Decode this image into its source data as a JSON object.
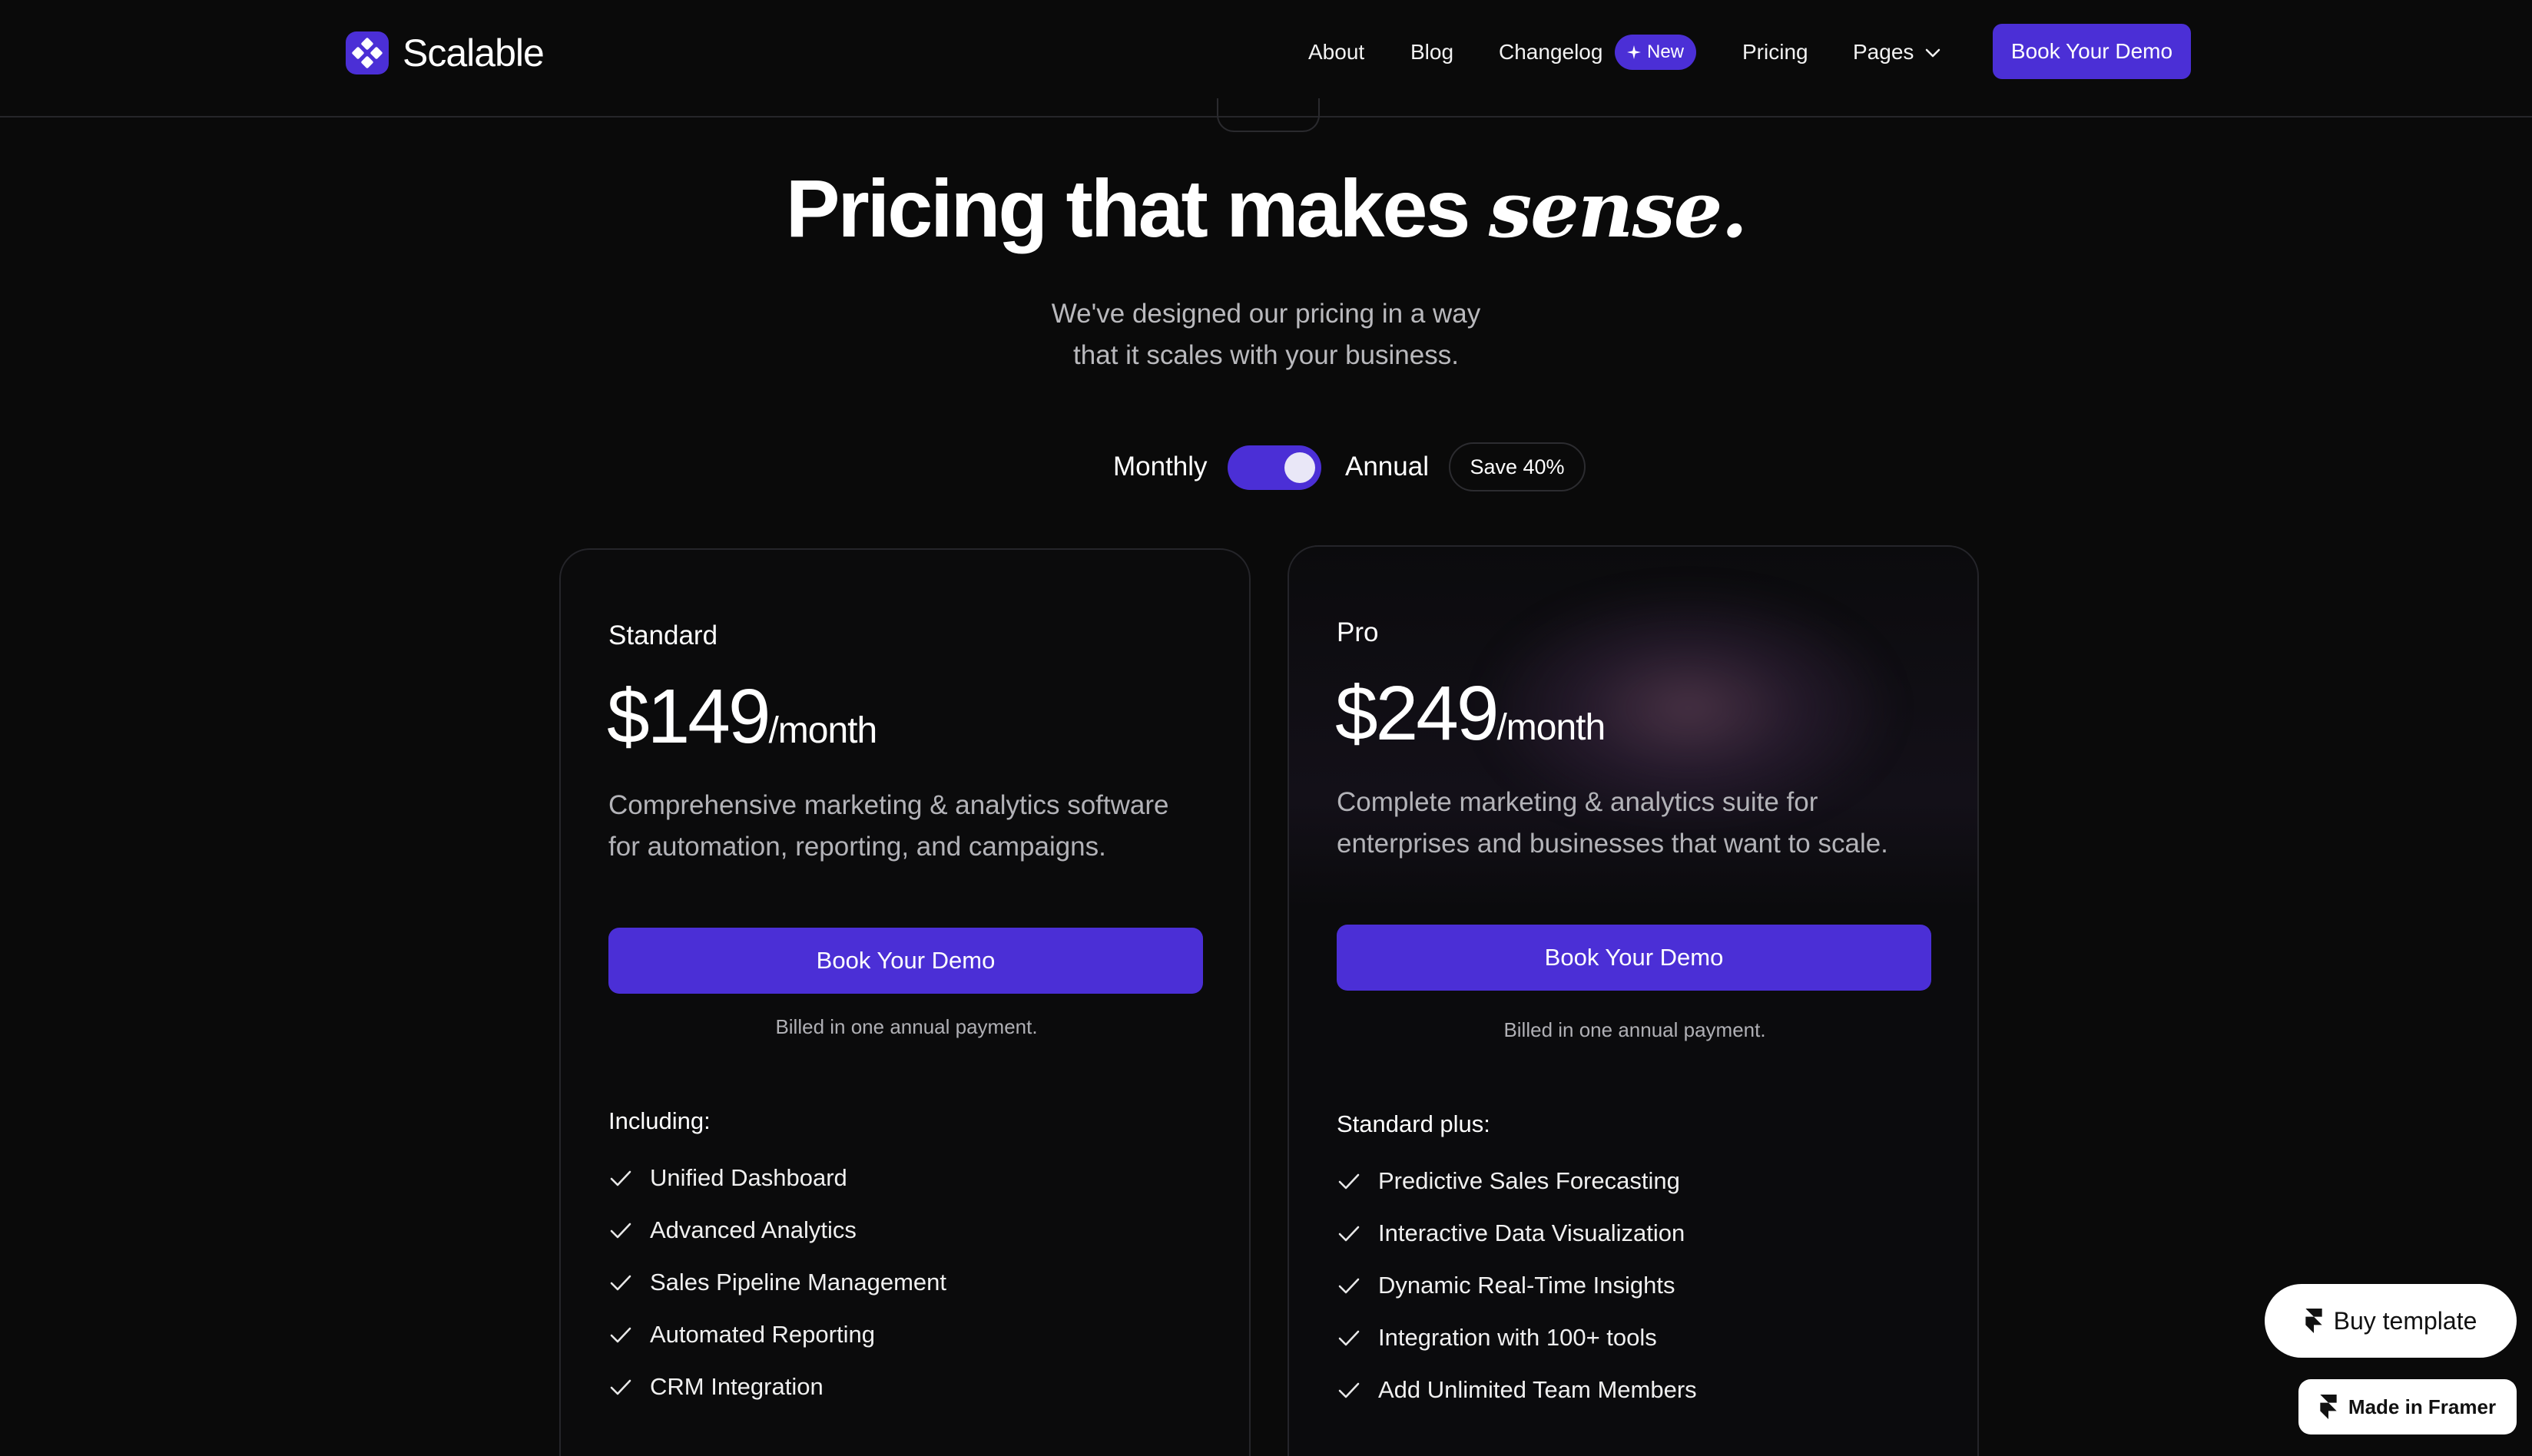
{
  "nav": {
    "brand": "Scalable",
    "links": [
      "About",
      "Blog",
      "Changelog",
      "Pricing",
      "Pages"
    ],
    "new_badge": "New",
    "cta": "Book Your Demo"
  },
  "hero": {
    "title_main": "Pricing that makes ",
    "title_emphasis": "sense.",
    "subtitle_line1": "We've designed our pricing in a way",
    "subtitle_line2": "that it scales with your business."
  },
  "billing": {
    "monthly_label": "Monthly",
    "annual_label": "Annual",
    "save_badge": "Save 40%",
    "annual_selected": true
  },
  "plans": [
    {
      "name": "Standard",
      "price": "$149",
      "period": "/month",
      "desc_line1": "Comprehensive marketing & analytics software",
      "desc_line2": "for automation, reporting, and campaigns.",
      "cta": "Book Your Demo",
      "billed_note": "Billed in one annual payment.",
      "features_label": "Including:",
      "features": [
        "Unified Dashboard",
        "Advanced Analytics",
        "Sales Pipeline Management",
        "Automated Reporting",
        "CRM Integration"
      ]
    },
    {
      "name": "Pro",
      "price": "$249",
      "period": "/month",
      "desc_line1": "Complete marketing & analytics suite for",
      "desc_line2": "enterprises and businesses that want to scale.",
      "cta": "Book Your Demo",
      "billed_note": "Billed in one annual payment.",
      "features_label": "Standard plus:",
      "features": [
        "Predictive Sales Forecasting",
        "Interactive Data Visualization",
        "Dynamic Real-Time Insights",
        "Integration with 100+ tools",
        "Add Unlimited Team Members"
      ]
    }
  ],
  "floating": {
    "buy_template": "Buy template",
    "made_in_framer": "Made in Framer"
  },
  "colors": {
    "background": "#0a0a0a",
    "accent": "#4b2fd6",
    "muted_text": "#b3b3b8"
  },
  "icons": [
    "logo-mark-icon",
    "sparkle-icon",
    "chevron-down-icon",
    "check-icon",
    "framer-icon"
  ]
}
